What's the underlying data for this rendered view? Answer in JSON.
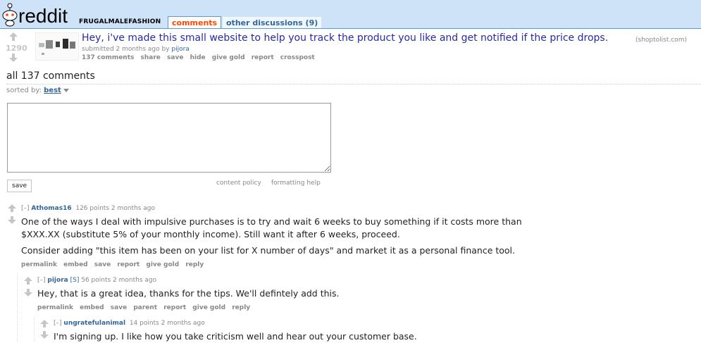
{
  "header": {
    "logo_text": "reddit",
    "subreddit": "FRUGALMALEFASHION",
    "tabs": [
      {
        "label": "comments"
      },
      {
        "label": "other discussions (9)"
      }
    ]
  },
  "post": {
    "score": "1290",
    "title": "Hey, i've made this small website to help you track the product you like and get notified if the price drops.",
    "domain": "(shoptolist.com)",
    "submitted": "submitted 2 months ago by",
    "author": "pijora",
    "buttons": [
      "137 comments",
      "share",
      "save",
      "hide",
      "give gold",
      "report",
      "crosspost"
    ]
  },
  "comments_header": {
    "title": "all 137 comments",
    "sorted_label": "sorted by:",
    "sort_value": "best"
  },
  "comment_form": {
    "textarea_value": "",
    "save_label": "save",
    "content_policy": "content policy",
    "formatting_help": "formatting help"
  },
  "comments": [
    {
      "toggle": "[–]",
      "author": "Athomas16",
      "flair": "",
      "meta": "126 points 2 months ago",
      "paragraphs": [
        "One of the ways I deal with impulsive purchases is to try and wait 6 weeks to buy something if it costs more than",
        "$XXX.XX (substitute 5% of your monthly income). Still want it after 6 weeks, proceed.",
        "Consider adding \"this item has been on your list for X number of days\" and market it as a personal finance tool."
      ],
      "buttons": [
        "permalink",
        "embed",
        "save",
        "report",
        "give gold",
        "reply"
      ]
    },
    {
      "toggle": "[–]",
      "author": "pijora",
      "flair": "[S]",
      "meta": "56 points 2 months ago",
      "paragraphs": [
        "Hey, that is a great idea, thanks for the tips. We'll defintely add this."
      ],
      "buttons": [
        "permalink",
        "embed",
        "save",
        "parent",
        "report",
        "give gold",
        "reply"
      ]
    },
    {
      "toggle": "[–]",
      "author": "ungratefulanimal",
      "flair": "",
      "meta": "14 points 2 months ago",
      "paragraphs": [
        "I'm signing up. I like how you take criticism well and hear out your customer base."
      ],
      "buttons": []
    }
  ]
}
